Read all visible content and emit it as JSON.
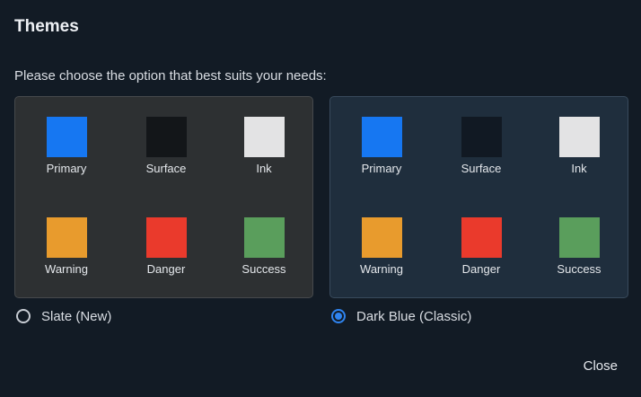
{
  "dialog": {
    "title": "Themes",
    "prompt": "Please choose the option that best suits your needs:",
    "close_label": "Close"
  },
  "themes": [
    {
      "name": "Slate (New)",
      "selected": false,
      "swatches": [
        {
          "label": "Primary",
          "color": "#1677f2"
        },
        {
          "label": "Surface",
          "color": "#131619"
        },
        {
          "label": "Ink",
          "color": "#e3e3e4"
        },
        {
          "label": "Warning",
          "color": "#e89b2d"
        },
        {
          "label": "Danger",
          "color": "#ea3a2c"
        },
        {
          "label": "Success",
          "color": "#5a9e5c"
        }
      ]
    },
    {
      "name": "Dark Blue (Classic)",
      "selected": true,
      "swatches": [
        {
          "label": "Primary",
          "color": "#1677f2"
        },
        {
          "label": "Surface",
          "color": "#111923"
        },
        {
          "label": "Ink",
          "color": "#e3e3e4"
        },
        {
          "label": "Warning",
          "color": "#e89b2d"
        },
        {
          "label": "Danger",
          "color": "#ea3a2c"
        },
        {
          "label": "Success",
          "color": "#5a9e5c"
        }
      ]
    }
  ]
}
